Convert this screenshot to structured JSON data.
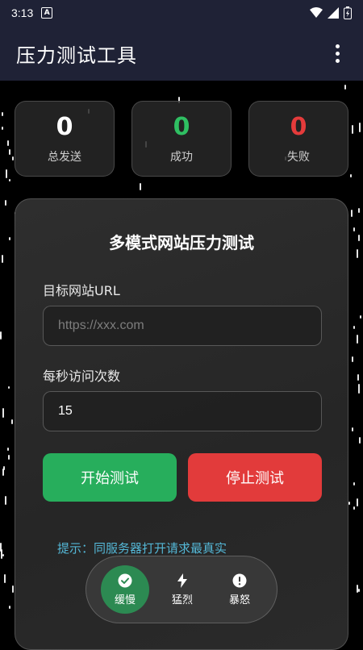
{
  "status_bar": {
    "time": "3:13",
    "notif_letter": "A"
  },
  "app_bar": {
    "title": "压力测试工具"
  },
  "stats": [
    {
      "value": "0",
      "label": "总发送",
      "color": "#ffffff"
    },
    {
      "value": "0",
      "label": "成功",
      "color": "#2fbf62"
    },
    {
      "value": "0",
      "label": "失败",
      "color": "#e43b3b"
    }
  ],
  "card": {
    "title": "多模式网站压力测试",
    "url_label": "目标网站URL",
    "url_placeholder": "https://xxx.com",
    "url_value": "",
    "rate_label": "每秒访问次数",
    "rate_value": "15",
    "start_label": "开始测试",
    "stop_label": "停止测试",
    "hint": "提示：同服务器打开请求最真实"
  },
  "nav": {
    "items": [
      {
        "label": "缓慢",
        "icon": "check-circle-icon",
        "active": true
      },
      {
        "label": "猛烈",
        "icon": "bolt-icon",
        "active": false
      },
      {
        "label": "暴怒",
        "icon": "alert-circle-icon",
        "active": false
      }
    ]
  },
  "colors": {
    "accent_green": "#27ae5c",
    "accent_red": "#e23b3b",
    "bar_bg": "#1f2236",
    "hint": "#54b7d6"
  }
}
